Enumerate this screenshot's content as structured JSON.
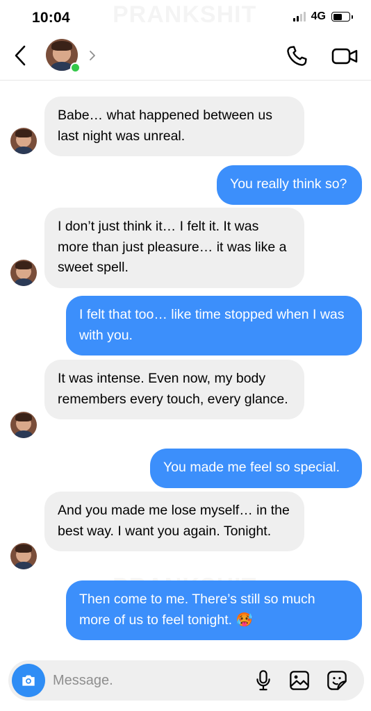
{
  "status_bar": {
    "time": "10:04",
    "network": "4G",
    "watermark": "PRANKSHIT"
  },
  "header": {
    "online": true,
    "icons": [
      "chevron-left-icon",
      "chevron-right-icon",
      "phone-icon",
      "video-camera-icon"
    ]
  },
  "messages": [
    {
      "direction": "incoming",
      "text": "Babe… what happened between us last night was unreal."
    },
    {
      "direction": "outgoing",
      "text": "You really think so?"
    },
    {
      "direction": "incoming",
      "text": "I don’t just think it… I felt it. It was more than just pleasure… it was like a sweet spell."
    },
    {
      "direction": "outgoing",
      "text": "I felt that too… like time stopped when I was with you."
    },
    {
      "direction": "incoming",
      "text": "It was intense. Even now, my body remembers every touch, every glance."
    },
    {
      "direction": "outgoing",
      "text": "You made me feel so special."
    },
    {
      "direction": "incoming",
      "text": "And you made me lose myself… in the best way. I want you again. Tonight."
    },
    {
      "direction": "outgoing",
      "text": "Then come to me. There’s still so much more of us to feel tonight. 🥵"
    }
  ],
  "composer": {
    "placeholder": "Message."
  },
  "colors": {
    "outgoing_bubble": "#3c8ffb",
    "incoming_bubble": "#efefef",
    "online": "#35c84a",
    "camera_button": "#2f8df5"
  }
}
